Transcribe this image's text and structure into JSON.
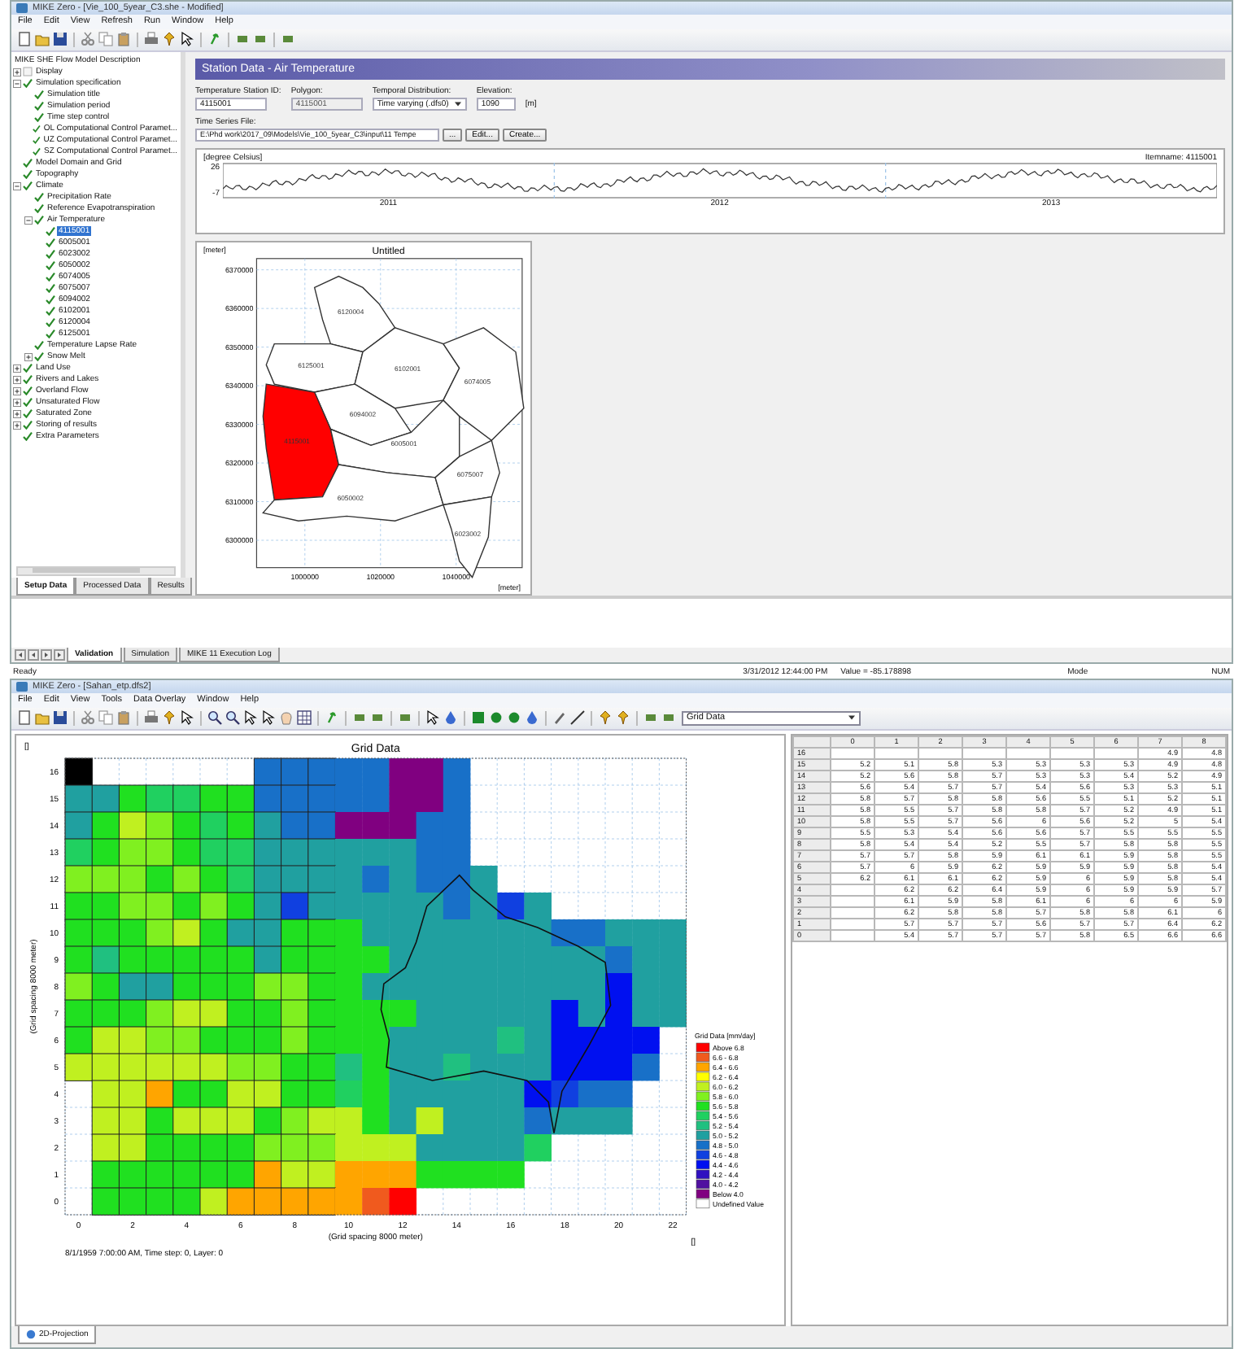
{
  "top_window": {
    "title": "MIKE Zero - [Vie_100_5year_C3.she - Modified]",
    "menu": [
      "File",
      "Edit",
      "View",
      "Refresh",
      "Run",
      "Window",
      "Help"
    ]
  },
  "tree": {
    "root_label": "MIKE SHE Flow Model Description",
    "items": [
      {
        "label": "Display",
        "checked": false,
        "expanded": false,
        "selected": false
      },
      {
        "label": "Simulation specification",
        "checked": true,
        "expanded": true,
        "selected": false,
        "children": [
          {
            "label": "Simulation title",
            "checked": true,
            "selected": false
          },
          {
            "label": "Simulation period",
            "checked": true,
            "selected": false
          },
          {
            "label": "Time step control",
            "checked": true,
            "selected": false
          },
          {
            "label": "OL Computational Control Paramet...",
            "checked": true,
            "selected": false
          },
          {
            "label": "UZ Computational Control Paramet...",
            "checked": true,
            "selected": false
          },
          {
            "label": "SZ Computational Control Paramet...",
            "checked": true,
            "selected": false
          }
        ]
      },
      {
        "label": "Model Domain and Grid",
        "checked": true,
        "selected": false
      },
      {
        "label": "Topography",
        "checked": true,
        "selected": false
      },
      {
        "label": "Climate",
        "checked": true,
        "expanded": true,
        "selected": false,
        "children": [
          {
            "label": "Precipitation Rate",
            "checked": true,
            "selected": false
          },
          {
            "label": "Reference Evapotranspiration",
            "checked": true,
            "selected": false
          },
          {
            "label": "Air Temperature",
            "checked": true,
            "expanded": true,
            "selected": false,
            "children": [
              {
                "label": "4115001",
                "checked": true,
                "selected": true
              },
              {
                "label": "6005001",
                "checked": true,
                "selected": false
              },
              {
                "label": "6023002",
                "checked": true,
                "selected": false
              },
              {
                "label": "6050002",
                "checked": true,
                "selected": false
              },
              {
                "label": "6074005",
                "checked": true,
                "selected": false
              },
              {
                "label": "6075007",
                "checked": true,
                "selected": false
              },
              {
                "label": "6094002",
                "checked": true,
                "selected": false
              },
              {
                "label": "6102001",
                "checked": true,
                "selected": false
              },
              {
                "label": "6120004",
                "checked": true,
                "selected": false
              },
              {
                "label": "6125001",
                "checked": true,
                "selected": false
              }
            ]
          },
          {
            "label": "Temperature Lapse Rate",
            "checked": true,
            "selected": false
          },
          {
            "label": "Snow Melt",
            "checked": true,
            "expanded": false,
            "selected": false
          }
        ]
      },
      {
        "label": "Land Use",
        "checked": true,
        "expanded": false,
        "selected": false
      },
      {
        "label": "Rivers and Lakes",
        "checked": true,
        "expanded": false,
        "selected": false
      },
      {
        "label": "Overland Flow",
        "checked": true,
        "expanded": false,
        "selected": false
      },
      {
        "label": "Unsaturated Flow",
        "checked": true,
        "expanded": false,
        "selected": false
      },
      {
        "label": "Saturated Zone",
        "checked": true,
        "expanded": false,
        "selected": false
      },
      {
        "label": "Storing of results",
        "checked": true,
        "expanded": false,
        "selected": false
      },
      {
        "label": "Extra Parameters",
        "checked": true,
        "selected": false
      }
    ]
  },
  "left_tabs": [
    {
      "label": "Setup Data",
      "selected": true
    },
    {
      "label": "Processed Data",
      "selected": false
    },
    {
      "label": "Results",
      "selected": false
    }
  ],
  "station": {
    "header": "Station Data - Air Temperature",
    "id_field": {
      "label": "Temperature Station ID:",
      "value": "4115001"
    },
    "polygon_field": {
      "label": "Polygon:",
      "value": "4115001",
      "disabled": true
    },
    "distribution_field": {
      "label": "Temporal Distribution:",
      "value": "Time varying (.dfs0)"
    },
    "elevation_field": {
      "label": "Elevation:",
      "value": "1090",
      "unit": "[m]"
    },
    "file_field": {
      "label": "Time Series File:",
      "value": "E:\\Phd work\\2017_09\\Models\\Vie_100_5year_C3\\input\\11 Tempe"
    },
    "buttons": [
      "...",
      "Edit...",
      "Create..."
    ]
  },
  "time_series": {
    "unit": "[degree Celsius]",
    "item_name": "Itemname: 4115001",
    "y_labels": [
      "26",
      "-7"
    ],
    "x_labels": [
      "2011",
      "2012",
      "2013"
    ]
  },
  "map": {
    "unit": "[meter]",
    "title": "Untitled",
    "y_labels": [
      "6370000",
      "6360000",
      "6350000",
      "6340000",
      "6330000",
      "6320000",
      "6310000",
      "6300000"
    ],
    "x_labels": [
      "1000000",
      "1020000",
      "1040000"
    ],
    "x_unit": "[meter]",
    "polygons": [
      {
        "label": "6120004",
        "selected": false
      },
      {
        "label": "6125001",
        "selected": false
      },
      {
        "label": "6102001",
        "selected": false
      },
      {
        "label": "6074005",
        "selected": false
      },
      {
        "label": "6094002",
        "selected": false
      },
      {
        "label": "4115001",
        "selected": true
      },
      {
        "label": "6005001",
        "selected": false
      },
      {
        "label": "6050002",
        "selected": false
      },
      {
        "label": "6075007",
        "selected": false
      },
      {
        "label": "6023002",
        "selected": false
      }
    ]
  },
  "output_tabs": [
    {
      "label": "Validation",
      "selected": true
    },
    {
      "label": "Simulation",
      "selected": false
    },
    {
      "label": "MIKE 11 Execution Log",
      "selected": false
    }
  ],
  "status_bar": {
    "message": "Ready",
    "time": "3/31/2012 12:44:00 PM",
    "value": "Value = -85.178898",
    "mode": "Mode",
    "num": "NUM"
  },
  "bottom_window": {
    "title": "MIKE Zero - [Sahan_etp.dfs2]",
    "menu": [
      "File",
      "Edit",
      "View",
      "Tools",
      "Data Overlay",
      "Window",
      "Help"
    ],
    "dropdown": "Grid Data"
  },
  "grid_chart": {
    "title": "Grid Data",
    "corner_unit": "[]",
    "x_unit": "[]",
    "xlabel": "(Grid spacing 8000 meter)",
    "ylabel": "(Grid spacing 8000 meter)",
    "x_labels": [
      "0",
      "2",
      "4",
      "6",
      "8",
      "10",
      "12",
      "14",
      "16",
      "18",
      "20",
      "22"
    ],
    "y_labels": [
      "16",
      "15",
      "14",
      "13",
      "12",
      "11",
      "10",
      "9",
      "8",
      "7",
      "6",
      "5",
      "4",
      "3",
      "2",
      "1",
      "0"
    ],
    "footer": "8/1/1959 7:00:00 AM, Time step: 0, Layer: 0",
    "legend": {
      "title": "Grid Data [mm/day]",
      "items": [
        {
          "label": "Above 6.8",
          "color": "#ff0000"
        },
        {
          "label": "6.6 - 6.8",
          "color": "#f05a1e"
        },
        {
          "label": "6.4 - 6.6",
          "color": "#ffa500"
        },
        {
          "label": "6.2 - 6.4",
          "color": "#ffff00"
        },
        {
          "label": "6.0 - 6.2",
          "color": "#c0f020"
        },
        {
          "label": "5.8 - 6.0",
          "color": "#80f020"
        },
        {
          "label": "5.6 - 5.8",
          "color": "#20e020"
        },
        {
          "label": "5.4 - 5.6",
          "color": "#20d060"
        },
        {
          "label": "5.2 - 5.4",
          "color": "#20c080"
        },
        {
          "label": "5.0 - 5.2",
          "color": "#20a0a0"
        },
        {
          "label": "4.8 - 5.0",
          "color": "#1870c8"
        },
        {
          "label": "4.6 - 4.8",
          "color": "#1040e0"
        },
        {
          "label": "4.4 - 4.6",
          "color": "#0010f0"
        },
        {
          "label": "4.2 - 4.4",
          "color": "#3010c0"
        },
        {
          "label": "4.0 - 4.2",
          "color": "#5010a0"
        },
        {
          "label": "Below 4.0",
          "color": "#800080"
        },
        {
          "label": "Undefined Value",
          "color": "#ffffff"
        }
      ]
    }
  },
  "table": {
    "columns": [
      "0",
      "1",
      "2",
      "3",
      "4",
      "5",
      "6",
      "7",
      "8"
    ],
    "rows": [
      {
        "label": "16",
        "cells": [
          null,
          null,
          null,
          null,
          null,
          null,
          null,
          "4.9",
          "4.8"
        ]
      },
      {
        "label": "15",
        "cells": [
          "5.2",
          "5.1",
          "5.8",
          "5.3",
          "5.3",
          "5.3",
          "5.3",
          "4.9",
          "4.8"
        ]
      },
      {
        "label": "14",
        "cells": [
          "5.2",
          "5.6",
          "5.8",
          "5.7",
          "5.3",
          "5.3",
          "5.4",
          "5.2",
          "4.9"
        ]
      },
      {
        "label": "13",
        "cells": [
          "5.6",
          "5.4",
          "5.7",
          "5.7",
          "5.4",
          "5.6",
          "5.3",
          "5.3",
          "5.1"
        ]
      },
      {
        "label": "12",
        "cells": [
          "5.8",
          "5.7",
          "5.8",
          "5.8",
          "5.6",
          "5.5",
          "5.1",
          "5.2",
          "5.1"
        ]
      },
      {
        "label": "11",
        "cells": [
          "5.8",
          "5.5",
          "5.7",
          "5.8",
          "5.8",
          "5.7",
          "5.2",
          "4.9",
          "5.1"
        ]
      },
      {
        "label": "10",
        "cells": [
          "5.8",
          "5.5",
          "5.7",
          "5.6",
          "6",
          "5.6",
          "5.2",
          "5",
          "5.4"
        ]
      },
      {
        "label": "9",
        "cells": [
          "5.5",
          "5.3",
          "5.4",
          "5.6",
          "5.6",
          "5.7",
          "5.5",
          "5.5",
          "5.5"
        ]
      },
      {
        "label": "8",
        "cells": [
          "5.8",
          "5.4",
          "5.4",
          "5.2",
          "5.5",
          "5.7",
          "5.8",
          "5.8",
          "5.5"
        ]
      },
      {
        "label": "7",
        "cells": [
          "5.7",
          "5.7",
          "5.8",
          "5.9",
          "6.1",
          "6.1",
          "5.9",
          "5.8",
          "5.5"
        ]
      },
      {
        "label": "6",
        "cells": [
          "5.7",
          "6",
          "5.9",
          "6.2",
          "5.9",
          "5.9",
          "5.9",
          "5.8",
          "5.4"
        ]
      },
      {
        "label": "5",
        "cells": [
          "6.2",
          "6.1",
          "6.1",
          "6.2",
          "5.9",
          "6",
          "5.9",
          "5.8",
          "5.4"
        ]
      },
      {
        "label": "4",
        "cells": [
          null,
          "6.2",
          "6.2",
          "6.4",
          "5.9",
          "6",
          "5.9",
          "5.9",
          "5.7"
        ]
      },
      {
        "label": "3",
        "cells": [
          null,
          "6.1",
          "5.9",
          "5.8",
          "6.1",
          "6",
          "6",
          "6",
          "5.9"
        ]
      },
      {
        "label": "2",
        "cells": [
          null,
          "6.2",
          "5.8",
          "5.8",
          "5.7",
          "5.8",
          "5.8",
          "6.1",
          "6"
        ]
      },
      {
        "label": "1",
        "cells": [
          null,
          "5.7",
          "5.7",
          "5.7",
          "5.6",
          "5.7",
          "5.7",
          "6.4",
          "6.2"
        ]
      },
      {
        "label": "0",
        "cells": [
          null,
          "5.4",
          "5.7",
          "5.7",
          "5.7",
          "5.8",
          "6.5",
          "6.6",
          "6.6"
        ]
      }
    ]
  },
  "bottom_tabs": [
    {
      "label": "2D-Projection",
      "selected": true
    }
  ]
}
